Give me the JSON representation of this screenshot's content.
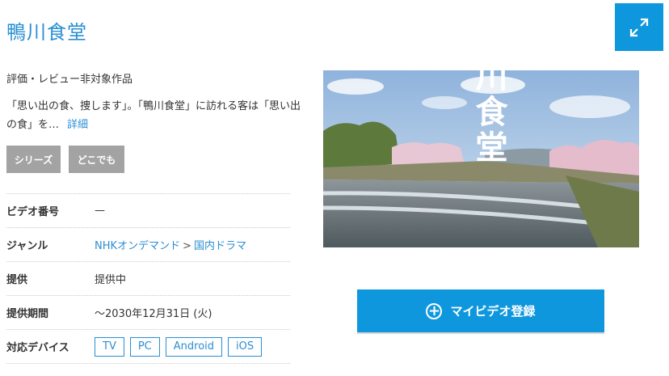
{
  "program": {
    "title": "鴨川食堂",
    "rating_note": "評価・レビュー非対象作品",
    "synopsis": "「思い出の食、捜します」。「鴨川食堂」に訪れる客は「思い出の食」を…",
    "detail_link": "詳細"
  },
  "tags": {
    "series": "シリーズ",
    "anywhere": "どこでも"
  },
  "info": {
    "video_number": {
      "label": "ビデオ番号",
      "value": "—"
    },
    "genre": {
      "label": "ジャンル",
      "link1": "NHKオンデマンド",
      "separator": ">",
      "link2": "国内ドラマ"
    },
    "provision": {
      "label": "提供",
      "value": "提供中"
    },
    "period": {
      "label": "提供期間",
      "value": "～2030年12月31日 (火)"
    },
    "devices": {
      "label": "対応デバイス",
      "items": [
        "TV",
        "PC",
        "Android",
        "iOS"
      ]
    }
  },
  "thumbnail": {
    "caption": "鴨川食堂"
  },
  "register": {
    "label": "マイビデオ登録"
  },
  "colors": {
    "accent": "#0f97de",
    "link": "#2a8fd3",
    "tag_bg": "#a3a3a3"
  }
}
